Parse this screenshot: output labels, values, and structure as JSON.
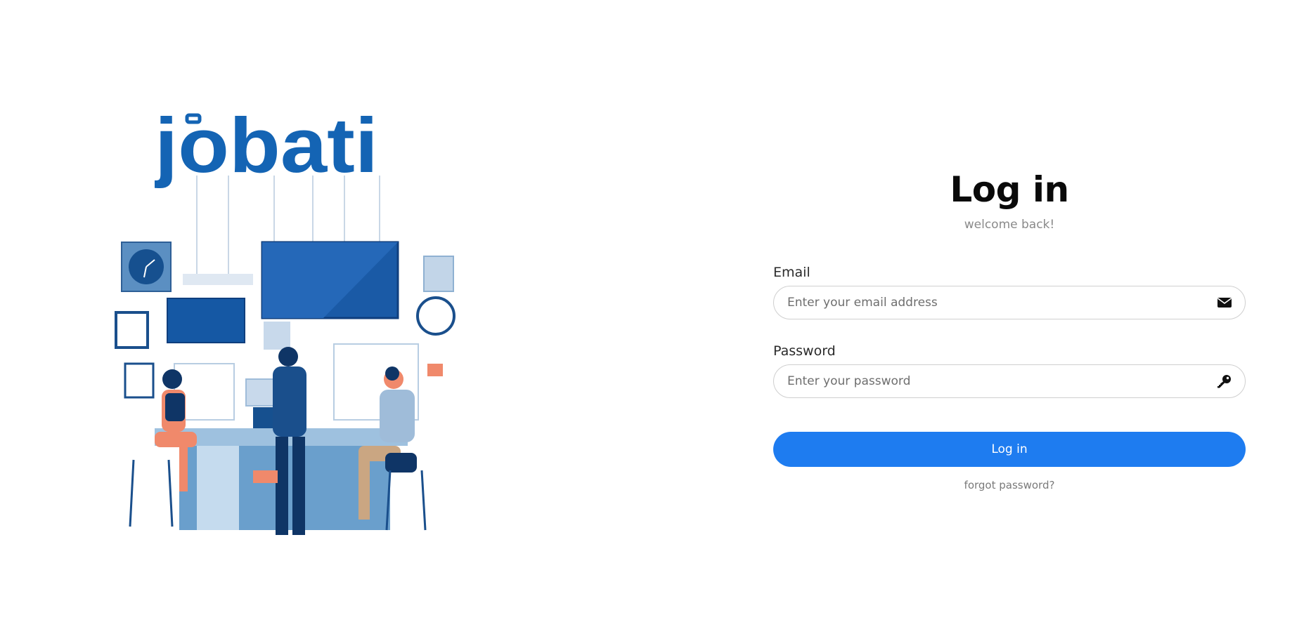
{
  "brand": {
    "logo_text": "jobati",
    "logo_color": "#1464b4"
  },
  "login": {
    "title": "Log in",
    "subtitle": "welcome back!",
    "email": {
      "label": "Email",
      "placeholder": "Enter your email address",
      "value": "",
      "icon": "envelope-icon"
    },
    "password": {
      "label": "Password",
      "placeholder": "Enter your password",
      "value": "",
      "icon": "key-icon"
    },
    "submit_label": "Log in",
    "forgot_label": "forgot password?"
  },
  "colors": {
    "accent": "#1e7cf0",
    "text_dark": "#0a0a0a",
    "text_muted": "#8a8a8a",
    "border": "#cfcfcf"
  }
}
